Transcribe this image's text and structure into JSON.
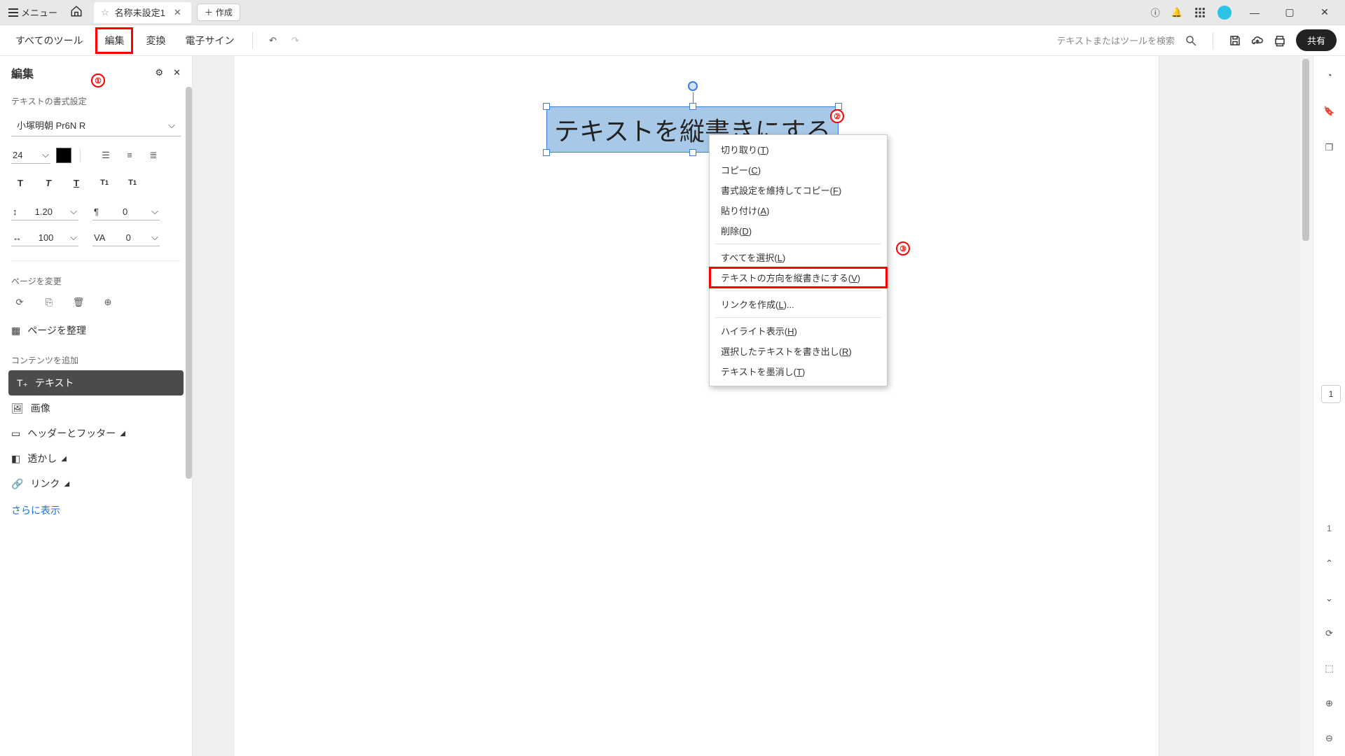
{
  "titlebar": {
    "menu_label": "メニュー",
    "tab_title": "名称未設定1",
    "create_label": "作成"
  },
  "topbar": {
    "all_tools": "すべてのツール",
    "edit": "編集",
    "convert": "変換",
    "esign": "電子サイン",
    "search_placeholder": "テキストまたはツールを検索",
    "share": "共有"
  },
  "left_panel": {
    "title": "編集",
    "text_format_label": "テキストの書式設定",
    "font_name": "小塚明朝 Pr6N R",
    "font_size": "24",
    "line_height": "1.20",
    "para_space": "0",
    "scale_h": "100",
    "kerning": "0",
    "page_change_label": "ページを変更",
    "organize_pages": "ページを整理",
    "add_content_label": "コンテンツを追加",
    "add_text": "テキスト",
    "add_image": "画像",
    "add_hf": "ヘッダーとフッター",
    "add_watermark": "透かし",
    "add_link": "リンク",
    "more": "さらに表示"
  },
  "textbox": {
    "content": "テキストを縦書きにする"
  },
  "context_menu": {
    "items": [
      {
        "label": "切り取り",
        "short": "T"
      },
      {
        "label": "コピー",
        "short": "C"
      },
      {
        "label": "書式設定を維持してコピー",
        "short": "F"
      },
      {
        "label": "貼り付け",
        "short": "A"
      },
      {
        "label": "削除",
        "short": "D"
      },
      {
        "sep": true
      },
      {
        "label": "すべてを選択",
        "short": "L"
      },
      {
        "label": "テキストの方向を縦書きにする",
        "short": "V",
        "highlight": true
      },
      {
        "sep": true
      },
      {
        "label": "リンクを作成",
        "short": "L",
        "suffix": "..."
      },
      {
        "sep": true
      },
      {
        "label": "ハイライト表示",
        "short": "H"
      },
      {
        "label": "選択したテキストを書き出し",
        "short": "R"
      },
      {
        "label": "テキストを墨消し",
        "short": "T"
      }
    ]
  },
  "right_rail": {
    "page_badge": "1",
    "page_current": "1"
  },
  "annotations": {
    "a1": "①",
    "a2": "②",
    "a3": "③"
  }
}
